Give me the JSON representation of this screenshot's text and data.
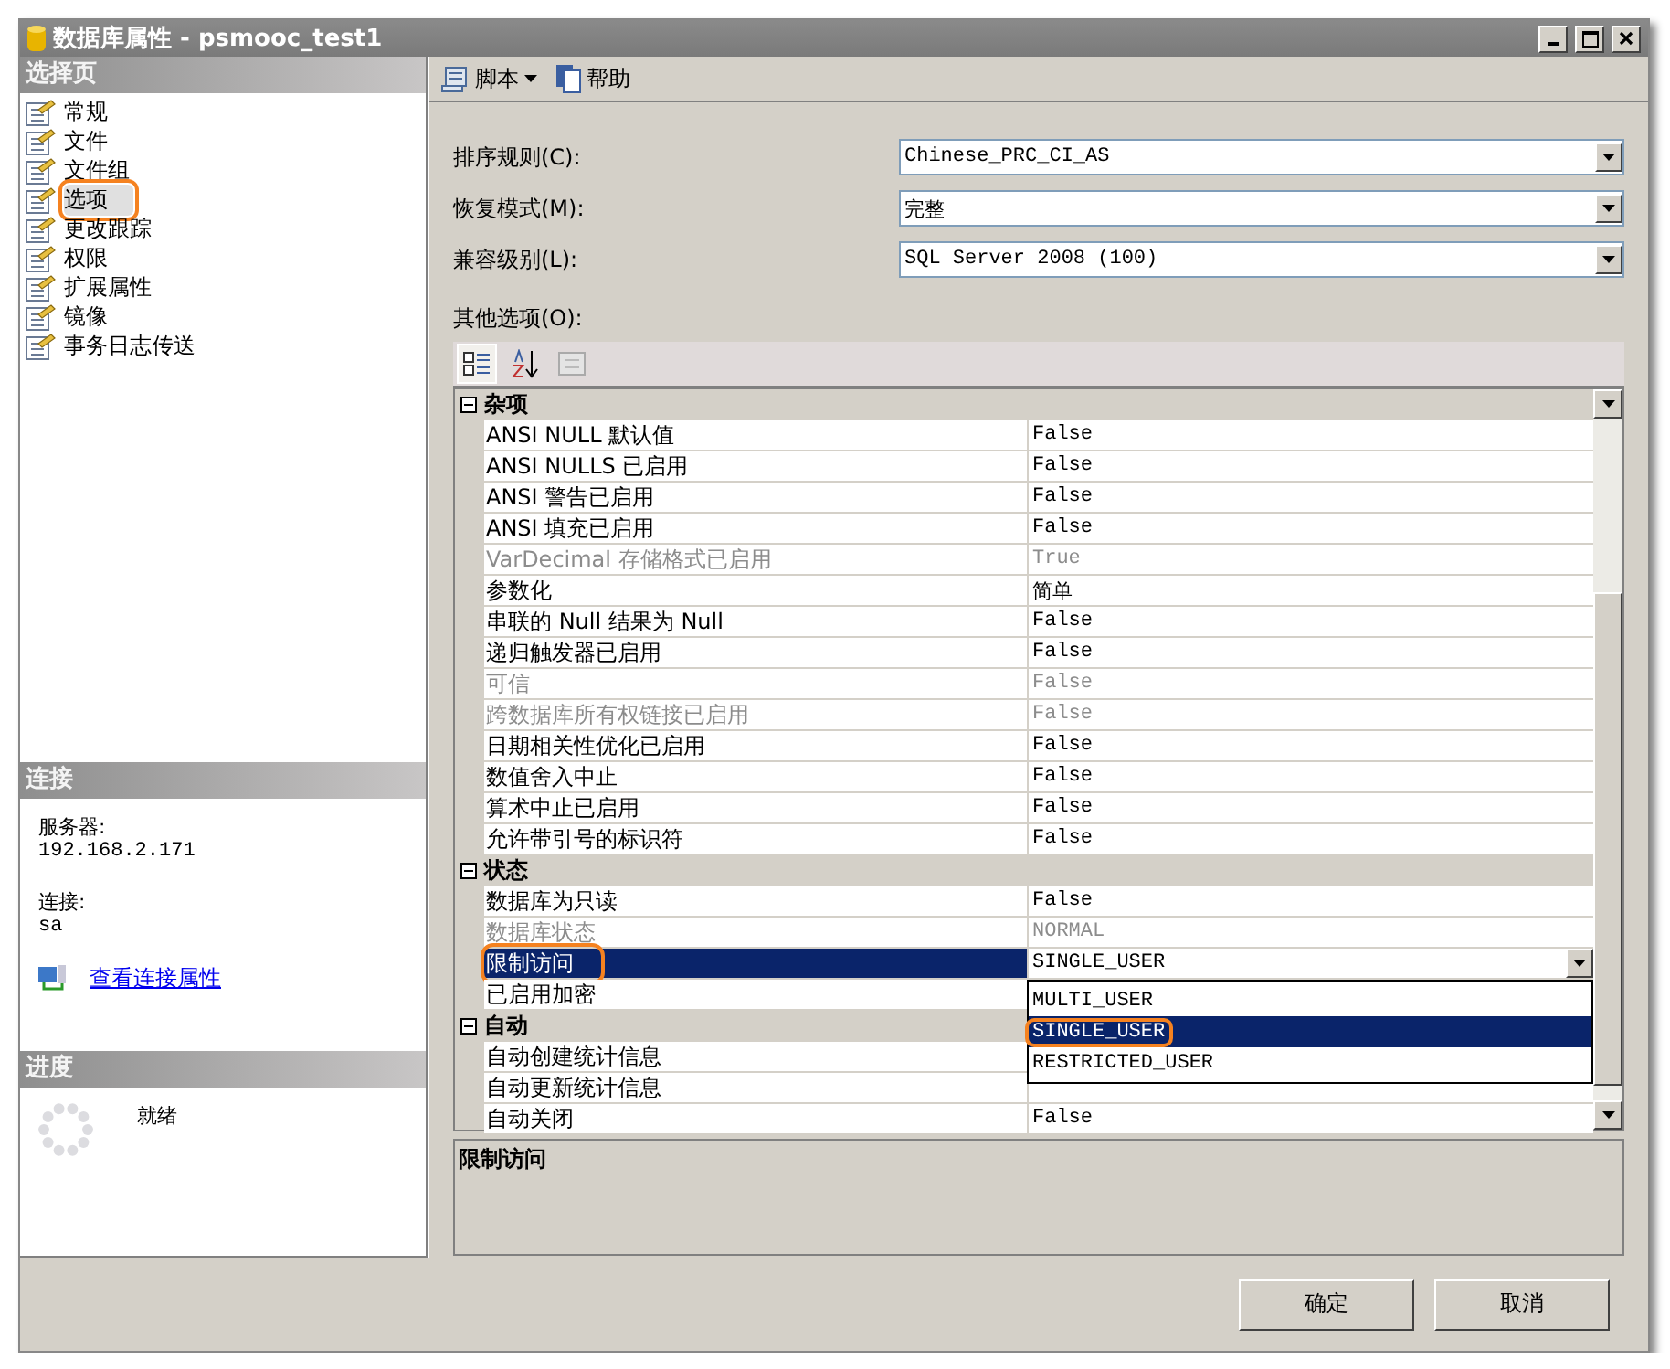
{
  "window": {
    "title": "数据库属性 - psmooc_test1"
  },
  "sidebar": {
    "header": "选择页",
    "items": [
      {
        "label": "常规",
        "selected": false
      },
      {
        "label": "文件",
        "selected": false
      },
      {
        "label": "文件组",
        "selected": false
      },
      {
        "label": "选项",
        "selected": true,
        "annotated": true
      },
      {
        "label": "更改跟踪",
        "selected": false
      },
      {
        "label": "权限",
        "selected": false
      },
      {
        "label": "扩展属性",
        "selected": false
      },
      {
        "label": "镜像",
        "selected": false
      },
      {
        "label": "事务日志传送",
        "selected": false
      }
    ]
  },
  "connection": {
    "header": "连接",
    "server_label": "服务器:",
    "server": "192.168.2.171",
    "login_label": "连接:",
    "login": "sa",
    "link": "查看连接属性"
  },
  "progress": {
    "header": "进度",
    "status": "就绪"
  },
  "toolbar": {
    "script": "脚本",
    "help": "帮助"
  },
  "fields": [
    {
      "label": "排序规则(C):",
      "value": "Chinese_PRC_CI_AS"
    },
    {
      "label": "恢复模式(M):",
      "value": "完整"
    },
    {
      "label": "兼容级别(L):",
      "value": "SQL Server 2008 (100)"
    }
  ],
  "other_options_label": "其他选项(O):",
  "property_grid": {
    "categories": [
      {
        "name": "杂项",
        "expanded": true,
        "rows": [
          {
            "name": "ANSI NULL 默认值",
            "value": "False",
            "disabled": false,
            "selected": false
          },
          {
            "name": "ANSI NULLS 已启用",
            "value": "False",
            "disabled": false,
            "selected": false
          },
          {
            "name": "ANSI 警告已启用",
            "value": "False",
            "disabled": false,
            "selected": false
          },
          {
            "name": "ANSI 填充已启用",
            "value": "False",
            "disabled": false,
            "selected": false
          },
          {
            "name": "VarDecimal 存储格式已启用",
            "value": "True",
            "disabled": true,
            "selected": false
          },
          {
            "name": "参数化",
            "value": "简单",
            "disabled": false,
            "selected": false
          },
          {
            "name": "串联的 Null 结果为 Null",
            "value": "False",
            "disabled": false,
            "selected": false
          },
          {
            "name": "递归触发器已启用",
            "value": "False",
            "disabled": false,
            "selected": false
          },
          {
            "name": "可信",
            "value": "False",
            "disabled": true,
            "selected": false
          },
          {
            "name": "跨数据库所有权链接已启用",
            "value": "False",
            "disabled": true,
            "selected": false
          },
          {
            "name": "日期相关性优化已启用",
            "value": "False",
            "disabled": false,
            "selected": false
          },
          {
            "name": "数值舍入中止",
            "value": "False",
            "disabled": false,
            "selected": false
          },
          {
            "name": "算术中止已启用",
            "value": "False",
            "disabled": false,
            "selected": false
          },
          {
            "name": "允许带引号的标识符",
            "value": "False",
            "disabled": false,
            "selected": false
          }
        ]
      },
      {
        "name": "状态",
        "expanded": true,
        "rows": [
          {
            "name": "数据库为只读",
            "value": "False",
            "disabled": false,
            "selected": false
          },
          {
            "name": "数据库状态",
            "value": "NORMAL",
            "disabled": true,
            "selected": false
          },
          {
            "name": "限制访问",
            "value": "SINGLE_USER",
            "disabled": false,
            "selected": true,
            "annotated": true,
            "dropdown": [
              {
                "label": "MULTI_USER",
                "selected": false
              },
              {
                "label": "SINGLE_USER",
                "selected": true,
                "annotated": true
              },
              {
                "label": "RESTRICTED_USER",
                "selected": false
              }
            ]
          },
          {
            "name": "已启用加密",
            "disabled": false,
            "selected": false
          }
        ]
      },
      {
        "name": "自动",
        "expanded": true,
        "rows": [
          {
            "name": "自动创建统计信息",
            "disabled": false,
            "selected": false
          },
          {
            "name": "自动更新统计信息",
            "disabled": false,
            "selected": false
          },
          {
            "name": "自动关闭",
            "value": "False",
            "disabled": false,
            "selected": false
          }
        ]
      }
    ]
  },
  "description": {
    "title": "限制访问"
  },
  "buttons": [
    "确定",
    "取消"
  ]
}
